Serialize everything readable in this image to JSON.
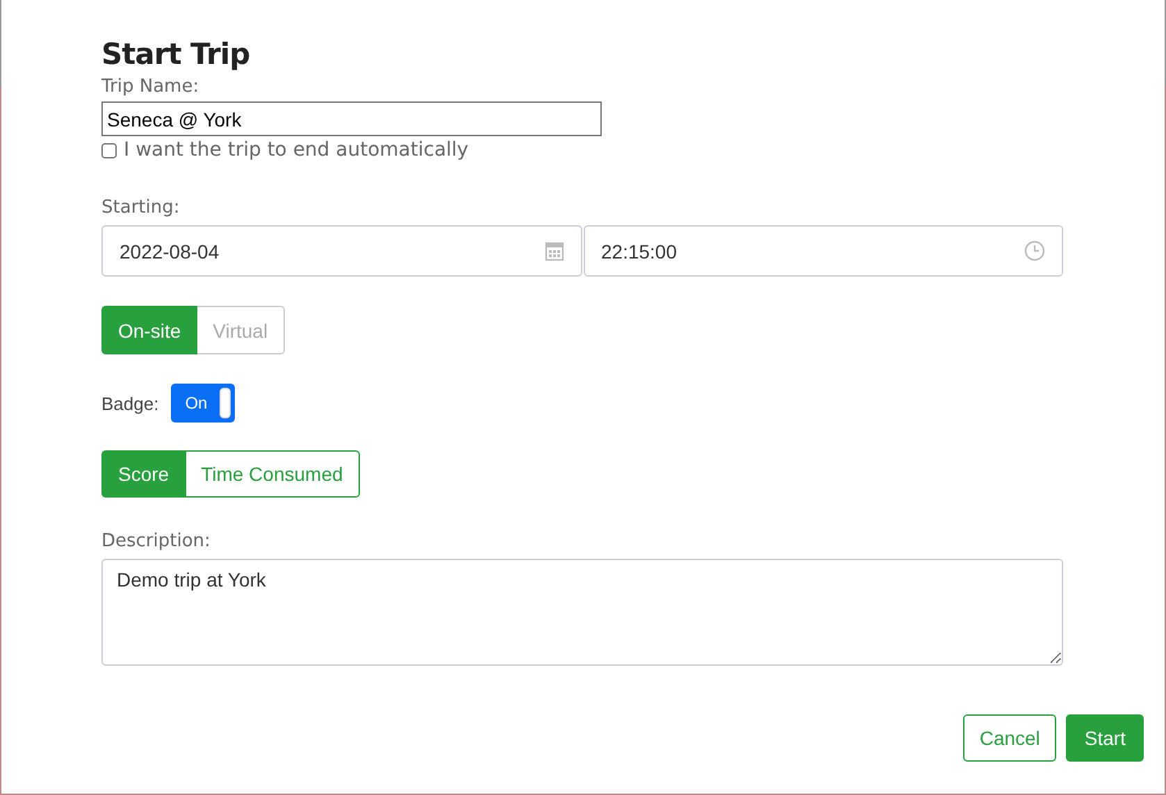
{
  "title": "Start Trip",
  "trip_name": {
    "label": "Trip Name:",
    "value": "Seneca @ York"
  },
  "auto_end": {
    "label": "I want the trip to end automatically",
    "checked": false
  },
  "starting": {
    "label": "Starting:",
    "date": "2022-08-04",
    "time": "22:15:00"
  },
  "mode_tabs": [
    {
      "label": "On-site",
      "selected": true
    },
    {
      "label": "Virtual",
      "selected": false
    }
  ],
  "badge": {
    "label": "Badge:",
    "on": true,
    "text": "On"
  },
  "scoring_tabs": [
    {
      "label": "Score",
      "selected": true
    },
    {
      "label": "Time Consumed",
      "selected": false
    }
  ],
  "description": {
    "label": "Description:",
    "value": "Demo trip at York"
  },
  "buttons": [
    {
      "label": "Cancel",
      "kind": "outline"
    },
    {
      "label": "Start",
      "kind": "primary"
    }
  ]
}
